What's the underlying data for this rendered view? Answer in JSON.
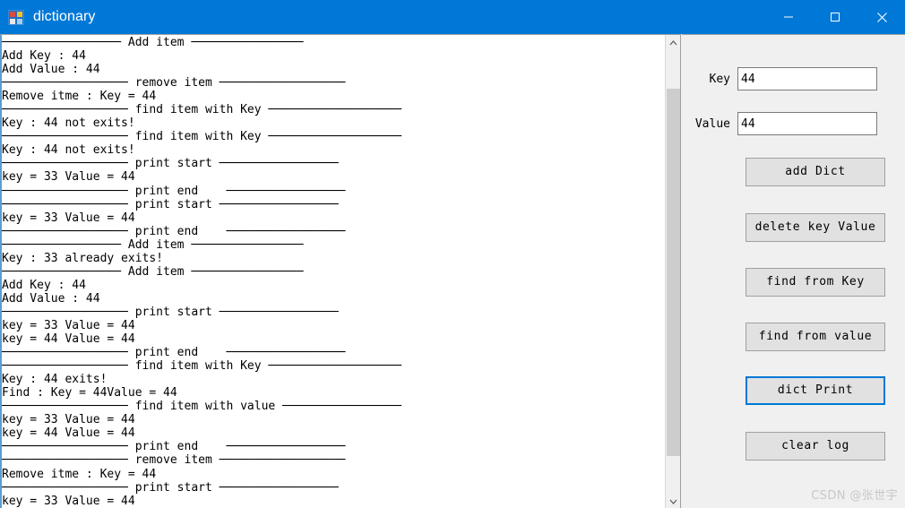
{
  "window": {
    "title": "dictionary",
    "icon": "app-window-icon",
    "accent_color": "#0078d7",
    "controls": [
      {
        "name": "minimize",
        "glyph": "minimize-icon"
      },
      {
        "name": "maximize",
        "glyph": "maximize-icon"
      },
      {
        "name": "close",
        "glyph": "close-icon"
      }
    ]
  },
  "log": {
    "content": "───────────────── Add item ────────────────\nAdd Key : 44\nAdd Value : 44\n────────────────── remove item ──────────────────\nRemove itme : Key = 44\n────────────────── find item with Key ───────────────────\nKey : 44 not exits!\n────────────────── find item with Key ───────────────────\nKey : 44 not exits!\n────────────────── print start ─────────────────\nkey = 33 Value = 44\n────────────────── print end    ─────────────────\n────────────────── print start ─────────────────\nkey = 33 Value = 44\n────────────────── print end    ─────────────────\n───────────────── Add item ────────────────\nKey : 33 already exits!\n───────────────── Add item ────────────────\nAdd Key : 44\nAdd Value : 44\n────────────────── print start ─────────────────\nkey = 33 Value = 44\nkey = 44 Value = 44\n────────────────── print end    ─────────────────\n────────────────── find item with Key ───────────────────\nKey : 44 exits!\nFind : Key = 44Value = 44\n────────────────── find item with value ─────────────────\nkey = 33 Value = 44\nkey = 44 Value = 44\n────────────────── print end    ─────────────────\n────────────────── remove item ──────────────────\nRemove itme : Key = 44\n────────────────── print start ─────────────────\nkey = 33 Value = 44",
    "scrollbar": {
      "up_arrow": "chevron-up-icon",
      "down_arrow": "chevron-down-icon"
    }
  },
  "panel": {
    "key_field": {
      "label": "Key",
      "value": "44",
      "placeholder": ""
    },
    "value_field": {
      "label": "Value",
      "value": "44",
      "placeholder": ""
    },
    "buttons": [
      {
        "label": "add Dict",
        "focused": false
      },
      {
        "label": "delete key Value",
        "focused": false
      },
      {
        "label": "find from Key",
        "focused": false
      },
      {
        "label": "find from value",
        "focused": false
      },
      {
        "label": "dict Print",
        "focused": true
      },
      {
        "label": "clear log",
        "focused": false
      }
    ]
  },
  "watermark": {
    "text": "CSDN @张世宇"
  }
}
